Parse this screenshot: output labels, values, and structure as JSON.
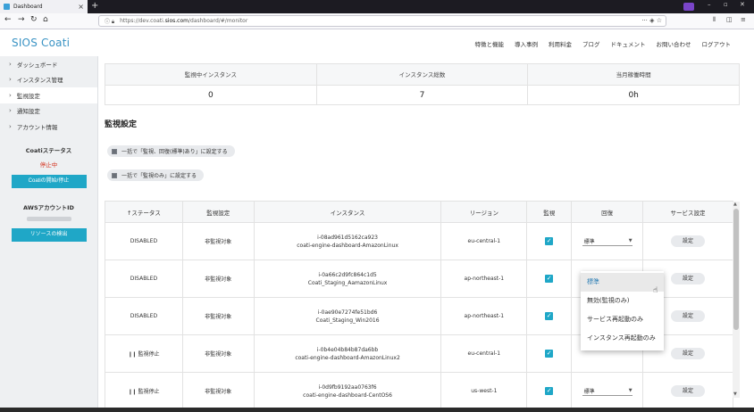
{
  "browser": {
    "tab_title": "Dashboard",
    "tab_close": "×",
    "new_tab": "+",
    "url_prefix": "https://dev.coati.",
    "url_domain": "sios.com",
    "url_path": "/dashboard/#/monitor",
    "win_min": "–",
    "win_max": "▫",
    "win_close": "✕"
  },
  "header": {
    "logo": "SIOS Coati",
    "nav": [
      "特徴と機能",
      "導入事例",
      "利用料金",
      "ブログ",
      "ドキュメント",
      "お問い合わせ",
      "ログアウト"
    ]
  },
  "sidebar": {
    "items": [
      "ダッシュボード",
      "インスタンス管理",
      "監視設定",
      "通知設定",
      "アカウント情報"
    ],
    "status_title": "Coatiステータス",
    "status_value": "停止中",
    "start_stop_button": "Coatiの開始/停止",
    "account_title": "AWSアカウントID",
    "detect_button": "リソースの検出"
  },
  "summary": {
    "headers": [
      "監視中インスタンス",
      "インスタンス総数",
      "当月稼働時間"
    ],
    "values": [
      "0",
      "7",
      "0h"
    ]
  },
  "section": {
    "title": "監視設定",
    "bulk_monitor_recover": "一括で「監視、回復(標準)あり」に設定する",
    "bulk_monitor_only": "一括で「監視のみ」に設定する"
  },
  "table": {
    "headers": [
      "↑ステータス",
      "監視設定",
      "インスタンス",
      "リージョン",
      "監視",
      "回復",
      "サービス設定"
    ],
    "rows": [
      {
        "status": "DISABLED",
        "setting": "非監視対象",
        "id": "i-08ad961d5162ca923",
        "name": "coati-engine-dashboard-AmazonLinux",
        "region": "eu-central-1",
        "recovery": "標準",
        "service": "設定"
      },
      {
        "status": "DISABLED",
        "setting": "非監視対象",
        "id": "i-0a66c2d9fc864c1d5",
        "name": "Coati_Staging_AamazonLinux",
        "region": "ap-northeast-1",
        "recovery": "",
        "service": "設定"
      },
      {
        "status": "DISABLED",
        "setting": "非監視対象",
        "id": "i-0ae90e7274fe51bd6",
        "name": "Coati_Staging_Win2016",
        "region": "ap-northeast-1",
        "recovery": "",
        "service": "設定"
      },
      {
        "status": "監視停止",
        "setting": "非監視対象",
        "id": "i-0b4e04b84b87da6bb",
        "name": "coati-engine-dashboard-AmazonLinux2",
        "region": "eu-central-1",
        "recovery": "",
        "service": "設定"
      },
      {
        "status": "監視停止",
        "setting": "非監視対象",
        "id": "i-0d9fb9192aa0763f6",
        "name": "coati-engine-dashboard-CentOS6",
        "region": "us-west-1",
        "recovery": "標準",
        "service": "設定"
      }
    ]
  },
  "dropdown": {
    "options": [
      "標準",
      "無効(監視のみ)",
      "サービス再起動のみ",
      "インスタンス再起動のみ"
    ],
    "selected": "標準"
  },
  "colors": {
    "accent": "#1fa7c7",
    "logo": "#3a93c4",
    "stopped": "#d4301c"
  }
}
